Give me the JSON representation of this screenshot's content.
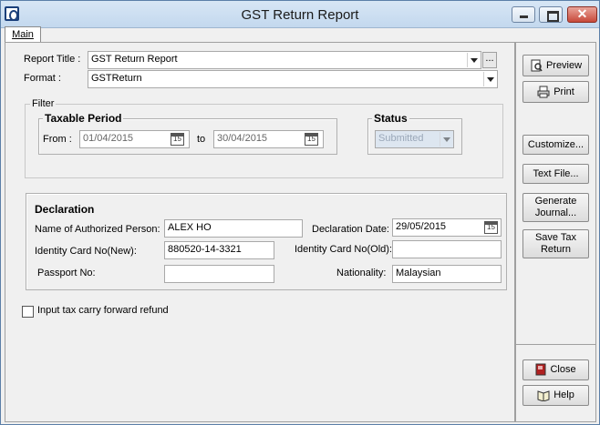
{
  "window": {
    "title": "GST Return Report"
  },
  "tabs": [
    {
      "label": "Main"
    }
  ],
  "report": {
    "title_label": "Report Title :",
    "title_value": "GST Return Report",
    "browse_label": "...",
    "format_label": "Format :",
    "format_value": "GSTReturn"
  },
  "filter": {
    "label": "Filter",
    "taxable_period": {
      "title": "Taxable Period",
      "from_label": "From :",
      "from_value": "01/04/2015",
      "to_label": "to",
      "to_value": "30/04/2015"
    },
    "status": {
      "title": "Status",
      "value": "Submitted"
    }
  },
  "declaration": {
    "title": "Declaration",
    "authorized_person_label": "Name of Authorized Person:",
    "authorized_person_value": "ALEX HO",
    "declaration_date_label": "Declaration Date:",
    "declaration_date_value": "29/05/2015",
    "ic_new_label": "Identity Card No(New):",
    "ic_new_value": "880520-14-3321",
    "ic_old_label": "Identity Card No(Old):",
    "ic_old_value": "",
    "passport_label": "Passport No:",
    "passport_value": "",
    "nationality_label": "Nationality:",
    "nationality_value": "Malaysian"
  },
  "options": {
    "carry_forward_label": "Input tax carry forward refund",
    "carry_forward_checked": false
  },
  "calendar_glyph": "15",
  "buttons": {
    "preview": "Preview",
    "print": "Print",
    "customize": "Customize...",
    "text_file": "Text File...",
    "generate_journal_1": "Generate",
    "generate_journal_2": "Journal...",
    "save_tax_return_1": "Save Tax",
    "save_tax_return_2": "Return",
    "close": "Close",
    "help": "Help"
  }
}
